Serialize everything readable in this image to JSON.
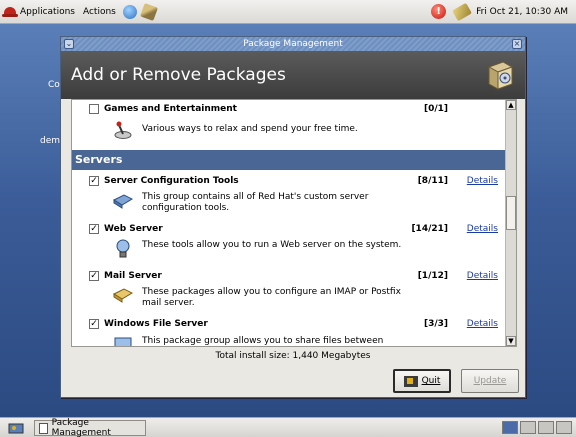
{
  "top_panel": {
    "applications": "Applications",
    "actions": "Actions",
    "clock": "Fri Oct 21, 10:30 AM"
  },
  "desktop": {
    "icon_label_1": "Co",
    "icon_label_2": "dem"
  },
  "window": {
    "title": "Package Management",
    "header_title": "Add or Remove Packages",
    "groups": [
      {
        "name": "Games and Entertainment",
        "checked": false,
        "count": "[0/1]",
        "description": "Various ways to relax and spend your free time.",
        "details": ""
      },
      {
        "name": "Server Configuration Tools",
        "checked": true,
        "count": "[8/11]",
        "description": "This group contains all of Red Hat's custom server configuration tools.",
        "details": "Details"
      },
      {
        "name": "Web Server",
        "checked": true,
        "count": "[14/21]",
        "description": "These tools allow you to run a Web server on the system.",
        "details": "Details"
      },
      {
        "name": "Mail Server",
        "checked": true,
        "count": "[1/12]",
        "description": "These packages allow you to configure an IMAP or Postfix mail server.",
        "details": "Details"
      },
      {
        "name": "Windows File Server",
        "checked": true,
        "count": "[3/3]",
        "description": "This package group allows you to share files between",
        "details": "Details"
      }
    ],
    "section_title": "Servers",
    "total_install": "Total install size: 1,440 Megabytes",
    "quit_label": "Quit",
    "update_label": "Update"
  },
  "bottom_panel": {
    "task": "Package Management"
  }
}
